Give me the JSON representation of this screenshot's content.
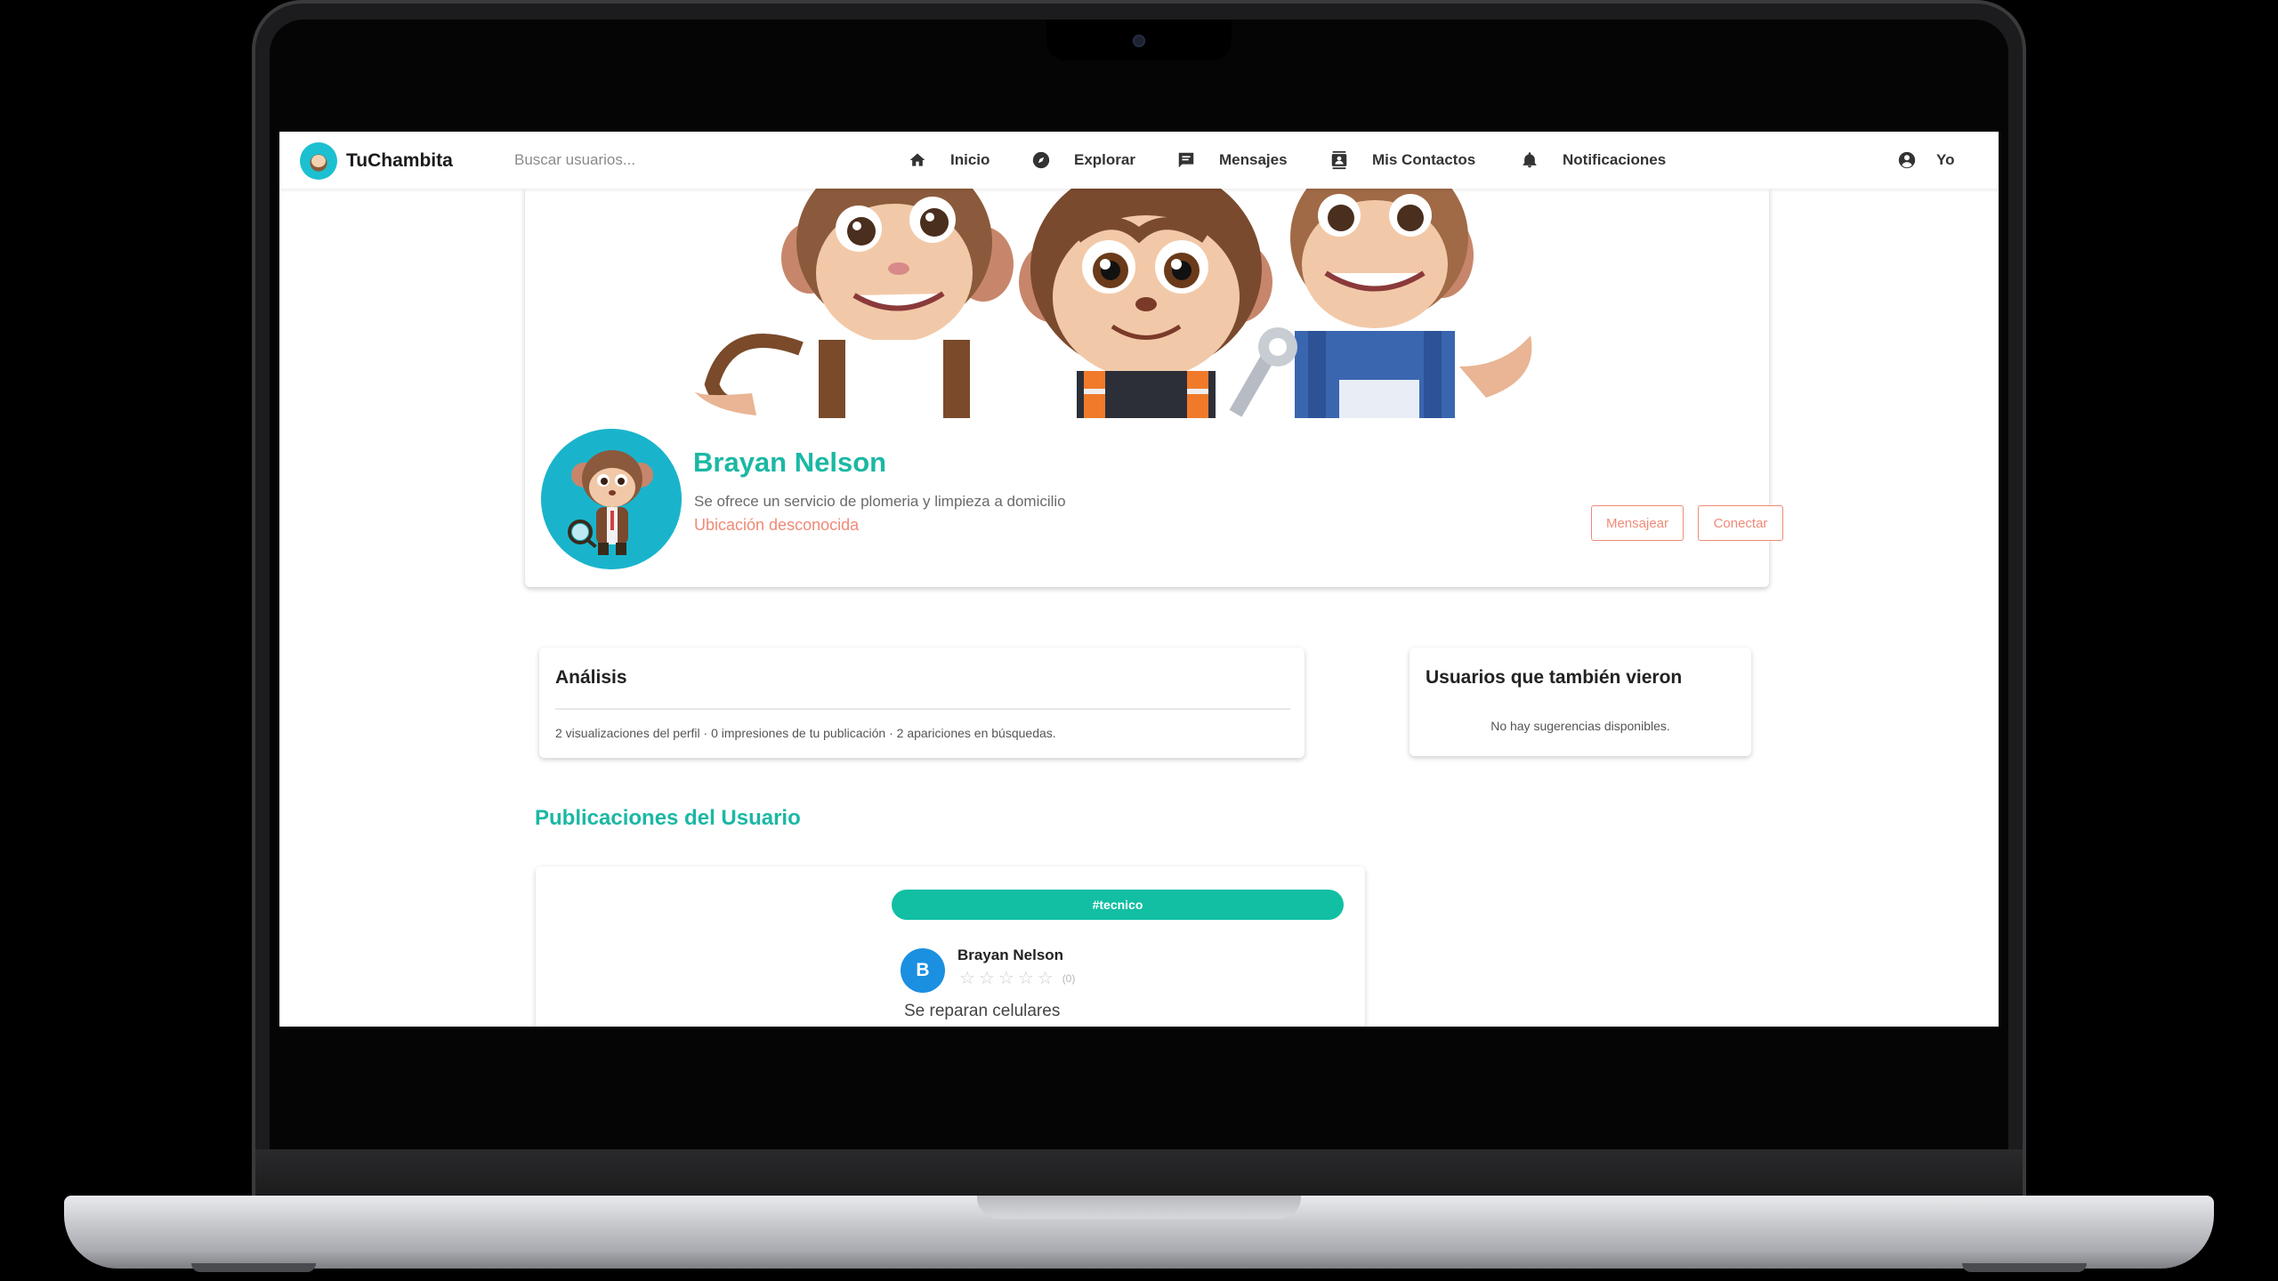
{
  "app": {
    "brand_name": "TuChambita"
  },
  "search": {
    "placeholder": "Buscar usuarios..."
  },
  "nav": {
    "inicio": "Inicio",
    "explorar": "Explorar",
    "mensajes": "Mensajes",
    "contactos": "Mis Contactos",
    "notificaciones": "Notificaciones",
    "yo": "Yo"
  },
  "profile": {
    "name": "Brayan Nelson",
    "headline": "Se ofrece un servicio de plomeria y limpieza a domicilio",
    "location": "Ubicación desconocida",
    "message_button": "Mensajear",
    "connect_button": "Conectar"
  },
  "analysis": {
    "title": "Análisis",
    "summary": "2 visualizaciones del perfil · 0 impresiones de tu publicación · 2 apariciones en búsquedas."
  },
  "also_viewed": {
    "title": "Usuarios que también vieron",
    "empty": "No hay sugerencias disponibles."
  },
  "posts": {
    "section_title": "Publicaciones del Usuario",
    "items": [
      {
        "tag": "#tecnico",
        "author_initial": "B",
        "author": "Brayan Nelson",
        "rating_count": "(0)",
        "text": "Se reparan celulares"
      }
    ]
  },
  "colors": {
    "accent": "#1bb8a4",
    "tag": "#12bfa3",
    "coral": "#f08a76",
    "avatar_blue": "#1b8fe0"
  }
}
